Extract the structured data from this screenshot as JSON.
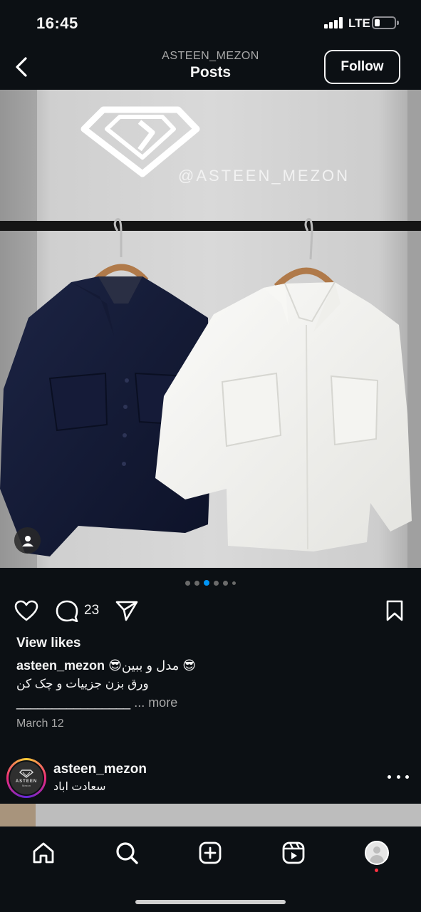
{
  "status_bar": {
    "time": "16:45",
    "network": "LTE",
    "battery_level": 0.2
  },
  "header": {
    "back_icon": "chevron-left-icon",
    "account": "ASTEEN_MEZON",
    "title": "Posts",
    "follow_label": "Follow"
  },
  "post": {
    "image": {
      "wall_sign": "@ASTEEN_MEZON",
      "user_tag_icon": "person-icon"
    },
    "carousel": {
      "count": 6,
      "active_index": 2
    },
    "actions": {
      "like_icon": "heart-icon",
      "comment_icon": "comment-icon",
      "comment_count": "23",
      "share_icon": "send-icon",
      "save_icon": "bookmark-icon"
    },
    "view_likes": "View likes",
    "caption": {
      "username": "asteen_mezon",
      "line1": "😎مدل و ببین 😎",
      "line2": "ورق بزن جزییات و چک کن",
      "line3": "________________",
      "more": "... more"
    },
    "date": "March 12"
  },
  "next_post": {
    "avatar_brand": "ASTEEN",
    "avatar_sub": "Mezon",
    "username": "asteen_mezon",
    "location": "سعادت اباد",
    "more_icon": "more-horizontal-icon"
  },
  "bottom_nav": {
    "items": [
      "home-icon",
      "search-icon",
      "create-icon",
      "reels-icon",
      "profile-avatar"
    ],
    "accent": "#0095f6",
    "notification_color": "#ff3040"
  }
}
